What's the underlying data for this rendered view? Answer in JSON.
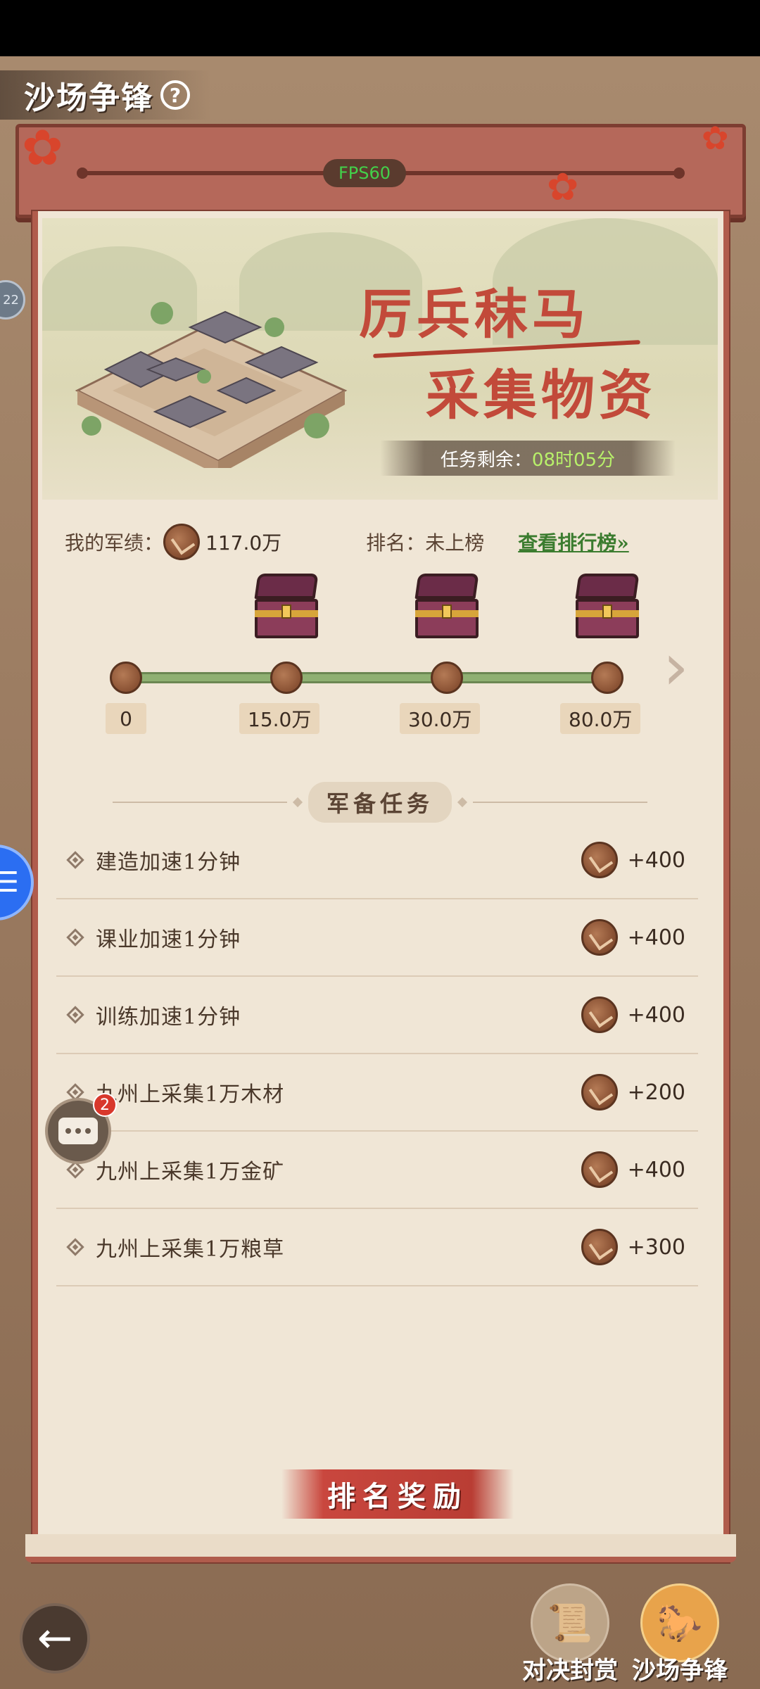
{
  "header": {
    "title": "沙场争锋",
    "help": "?"
  },
  "top_bar": {
    "fps": "FPS60"
  },
  "side": {
    "badge_text": "22",
    "chat_count": "2"
  },
  "banner": {
    "line1": "厉兵秣马",
    "line2": "采集物资",
    "task_remaining_label": "任务剩余：",
    "task_remaining_time": "08时05分"
  },
  "merit": {
    "label": "我的军绩：",
    "value": "117.0万",
    "rank_label": "排名：未上榜",
    "leaderboard_link": "查看排行榜»"
  },
  "progress": {
    "milestones": [
      "0",
      "15.0万",
      "30.0万",
      "80.0万"
    ],
    "current_value": "117.0万"
  },
  "section": {
    "title": "军备任务"
  },
  "tasks": [
    {
      "name": "建造加速1分钟",
      "reward": "+400"
    },
    {
      "name": "课业加速1分钟",
      "reward": "+400"
    },
    {
      "name": "训练加速1分钟",
      "reward": "+400"
    },
    {
      "name": "九州上采集1万木材",
      "reward": "+200"
    },
    {
      "name": "九州上采集1万金矿",
      "reward": "+400"
    },
    {
      "name": "九州上采集1万粮草",
      "reward": "+300"
    }
  ],
  "rank_reward_button": "排名奖励",
  "bottom_nav": {
    "back": "←",
    "items": [
      {
        "label": "对决封赏"
      },
      {
        "label": "沙场争锋"
      }
    ]
  },
  "colors": {
    "accent_red": "#c24a3a",
    "link_green": "#3b7c2f",
    "fps_green": "#43d04a",
    "progress_green": "#8fb072"
  }
}
